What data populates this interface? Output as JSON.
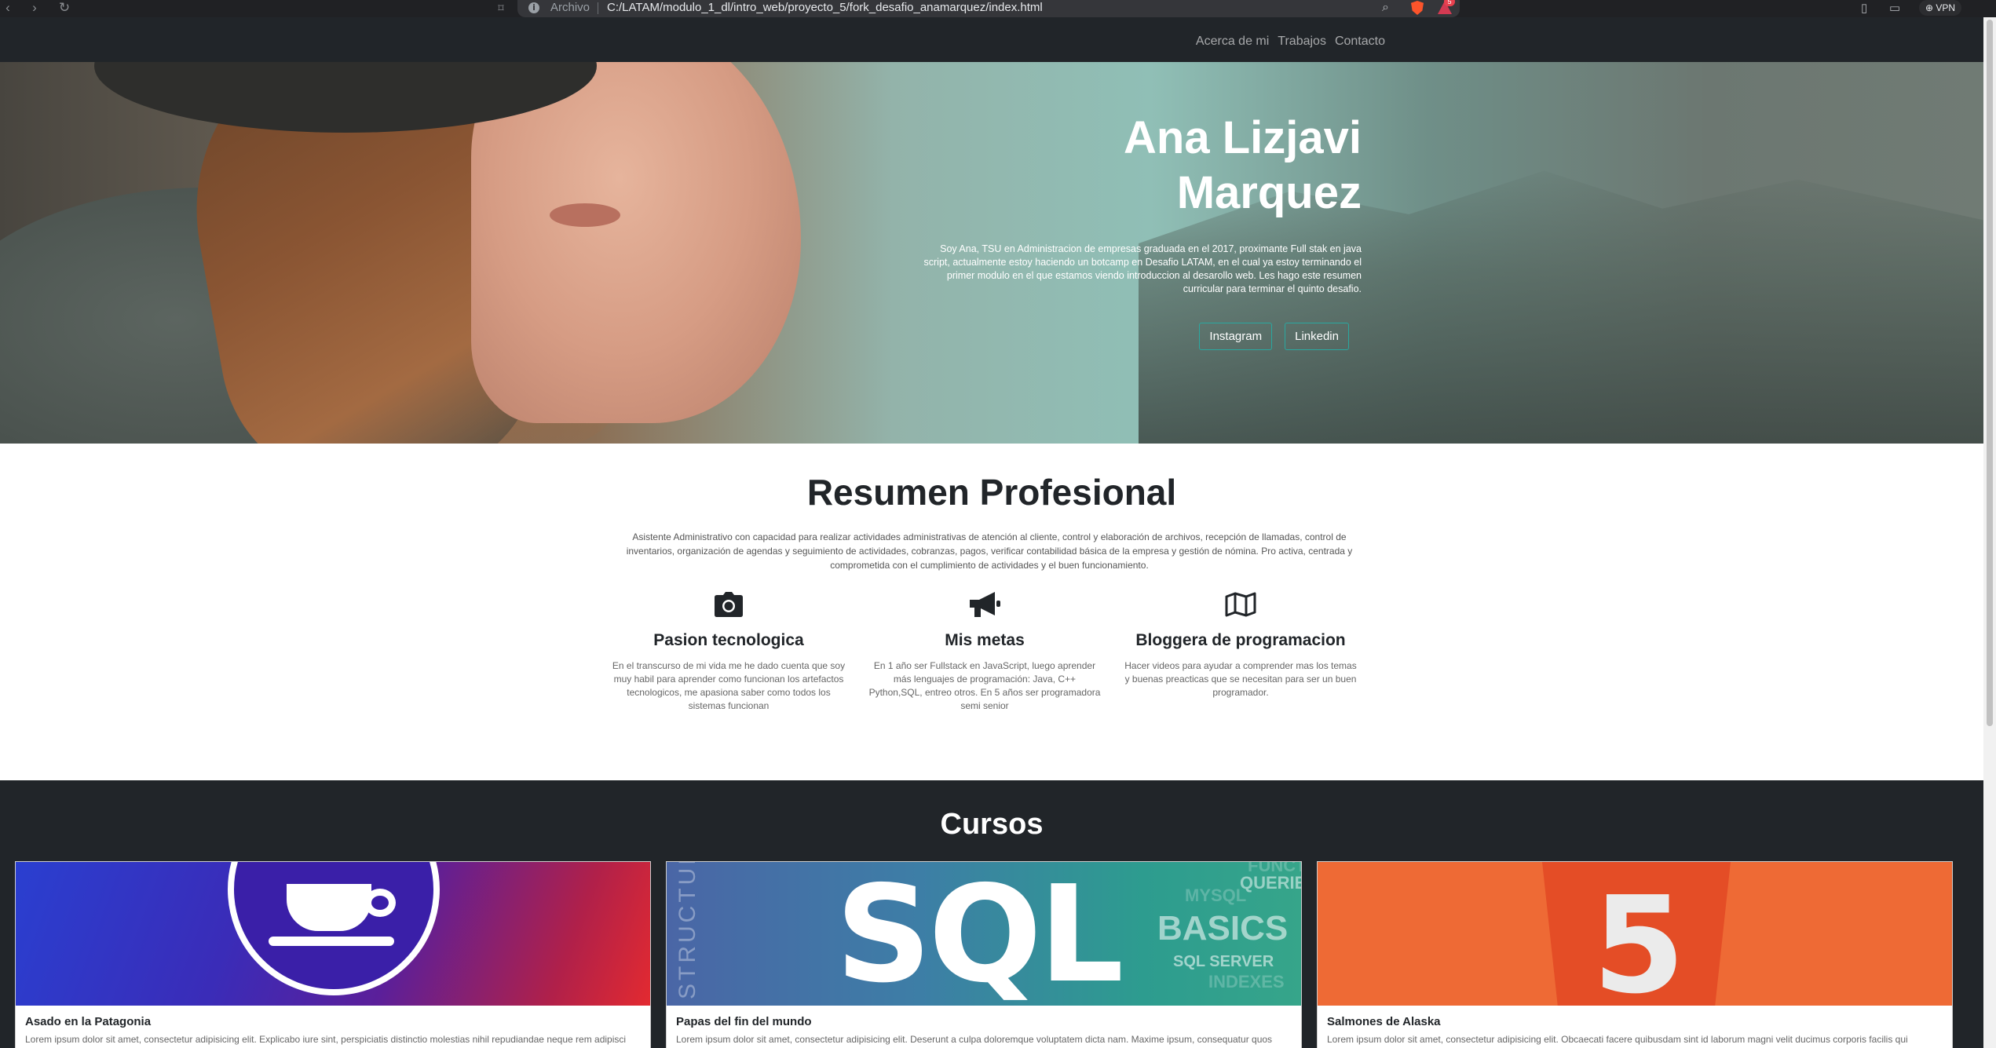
{
  "browser": {
    "location_label": "Archivo",
    "url": "C:/LATAM/modulo_1_dl/intro_web/proyecto_5/fork_desafio_anamarquez/index.html",
    "vpn_label": "VPN",
    "rewards_badge": "5"
  },
  "nav": {
    "links": [
      "Acerca de mi",
      "Trabajos",
      "Contacto"
    ]
  },
  "hero": {
    "name_line1": "Ana Lizjavi",
    "name_line2": "Marquez",
    "bio": "Soy Ana, TSU en Administracion de empresas graduada en el 2017, proximante Full stak en java script, actualmente estoy haciendo un botcamp en Desafio LATAM, en el cual ya estoy terminando el primer modulo en el que estamos viendo introduccion al desarollo web. Les hago este resumen curricular para terminar el quinto desafio.",
    "buttons": [
      "Instagram",
      "Linkedin"
    ]
  },
  "resumen": {
    "title": "Resumen Profesional",
    "text": "Asistente Administrativo con capacidad para realizar actividades administrativas de atención al cliente, control y elaboración de archivos, recepción de llamadas, control de inventarios, organización de agendas y seguimiento de actividades, cobranzas, pagos, verificar contabilidad básica de la empresa y gestión de nómina. Pro activa, centrada y comprometida con el cumplimiento de actividades y el buen funcionamiento.",
    "features": [
      {
        "icon": "camera-icon",
        "title": "Pasion tecnologica",
        "text": "En el transcurso de mi vida me he dado cuenta que soy muy habil para aprender como funcionan los artefactos tecnologicos, me apasiona saber como todos los sistemas funcionan"
      },
      {
        "icon": "megaphone-icon",
        "title": "Mis metas",
        "text": "En 1 año ser Fullstack en JavaScript, luego aprender más lenguajes de programación: Java, C++ Python,SQL, entreo otros. En 5 años ser programadora semi senior"
      },
      {
        "icon": "map-icon",
        "title": "Bloggera de programacion",
        "text": "Hacer videos para ayudar a comprender mas los temas y buenas preacticas que se necesitan para ser un buen programador."
      }
    ]
  },
  "cursos": {
    "title": "Cursos",
    "cards": [
      {
        "title": "Asado en la Patagonia",
        "text": "Lorem ipsum dolor sit amet, consectetur adipisicing elit. Explicabo iure sint, perspiciatis distinctio molestias nihil repudiandae neque rem adipisci repellendus libero illo quo blanditiis, velit quasi ad, recusandae voluptates officia"
      },
      {
        "title": "Papas del fin del mundo",
        "text": "Lorem ipsum dolor sit amet, consectetur adipisicing elit. Deserunt a culpa doloremque voluptatem dicta nam. Maxime ipsum, consequatur quos error fuga excepturi quo. Laudantium optio pariatur laboriosam modi, ea molestias?",
        "image_text": {
          "big": "SQL",
          "vertical": "STRUCTURED QUERY LANGUAGE",
          "basics": "BASICS",
          "server": "SQL SERVER",
          "small": [
            "QUERIES",
            "MYSQL",
            "FUNCTIONS",
            "INDEXES",
            "SQL",
            "STRUCTURE"
          ]
        }
      },
      {
        "title": "Salmones de Alaska",
        "text": "Lorem ipsum dolor sit amet, consectetur adipisicing elit. Obcaecati facere quibusdam sint id laborum magni velit ducimus corporis facilis qui architecto dolor, accusamus eveniet exercitationem fugit. Quod autem neque ducimus."
      }
    ]
  }
}
